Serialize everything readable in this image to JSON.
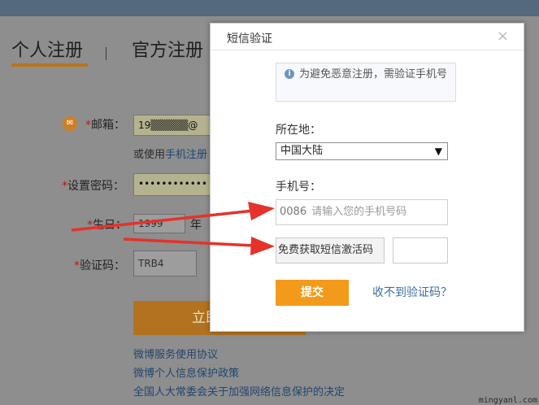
{
  "header": {
    "tab_personal": "个人注册",
    "tab_official": "官方注册"
  },
  "form": {
    "email_label": "邮箱：",
    "email_value": "19▒▒▒▒▒@",
    "alt_prefix": "或使用",
    "alt_link": "手机注册",
    "password_label": "设置密码：",
    "password_value": "••••••••••••",
    "birthday_label": "生日：",
    "birthday_year": "1999",
    "birthday_year_unit": "年",
    "captcha_label": "验证码：",
    "captcha_value": "TRB4",
    "submit_label": "立即注册",
    "required_mark": "*"
  },
  "footer": {
    "links": [
      "微博服务使用协议",
      "微博个人信息保护政策",
      "全国人大常委会关于加强网络信息保护的决定"
    ]
  },
  "modal": {
    "title": "短信验证",
    "close": "×",
    "notice": "为避免恶意注册，需验证手机号",
    "location_label": "所在地：",
    "location_value": "中国大陆",
    "phone_label": "手机号：",
    "phone_code": "0086",
    "phone_placeholder": "请输入您的手机号码",
    "get_code_label": "免费获取短信激活码",
    "submit_label": "提交",
    "no_code_link": "收不到验证码？"
  },
  "watermark": "mingyanl.com",
  "colors": {
    "accent_orange": "#f39a1b",
    "arrow_red": "#e5322b",
    "link_blue": "#3a6e9f"
  }
}
